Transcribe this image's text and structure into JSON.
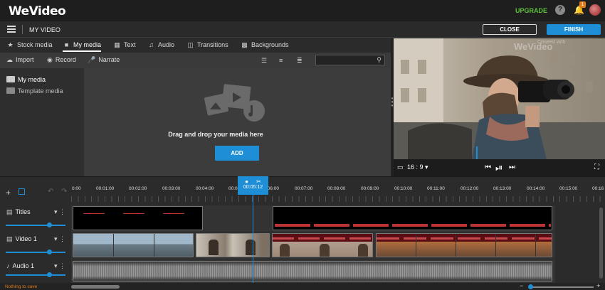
{
  "header": {
    "logo": "WeVideo",
    "upgrade": "UPGRADE",
    "help": "?",
    "notification_count": "1"
  },
  "project": {
    "title": "MY VIDEO",
    "close_label": "CLOSE",
    "finish_label": "FINISH"
  },
  "tabs": [
    {
      "label": "Stock media",
      "icon": "star-icon"
    },
    {
      "label": "My media",
      "icon": "folder-icon"
    },
    {
      "label": "Text",
      "icon": "text-icon"
    },
    {
      "label": "Audio",
      "icon": "music-icon"
    },
    {
      "label": "Transitions",
      "icon": "transitions-icon"
    },
    {
      "label": "Backgrounds",
      "icon": "backgrounds-icon"
    }
  ],
  "toolbar": {
    "import": "Import",
    "record": "Record",
    "narrate": "Narrate"
  },
  "sidebar": {
    "items": [
      {
        "label": "My media"
      },
      {
        "label": "Template media"
      }
    ]
  },
  "dropzone": {
    "text": "Drag and drop your media here",
    "add_label": "ADD"
  },
  "preview": {
    "watermark_small": "Created with",
    "watermark": "WeVideo",
    "aspect": "16 : 9"
  },
  "timeline": {
    "playhead_time": "00:05:12",
    "ticks": [
      "0:00",
      "00:01:00",
      "00:02:00",
      "00:03:00",
      "00:04:00",
      "00:05:00",
      "00:06:00",
      "00:07:00",
      "00:08:00",
      "00:09:00",
      "00:10:00",
      "00:11:00",
      "00:12:00",
      "00:13:00",
      "00:14:00",
      "00:15:00",
      "00:16"
    ],
    "tracks": [
      {
        "name": "Titles"
      },
      {
        "name": "Video 1"
      },
      {
        "name": "Audio 1"
      }
    ],
    "status": "Nothing to save"
  },
  "colors": {
    "accent": "#1e8fd6",
    "upgrade": "#5fc13d",
    "status": "#e07b1a"
  }
}
